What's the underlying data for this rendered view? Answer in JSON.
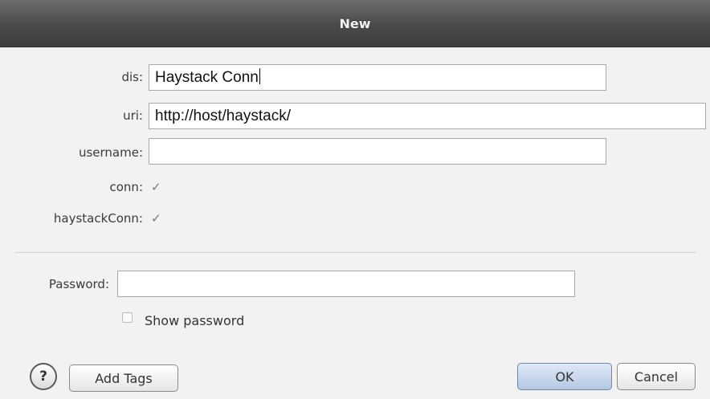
{
  "dialog": {
    "title": "New"
  },
  "fields": {
    "dis": {
      "label": "dis:",
      "value": "Haystack Conn"
    },
    "uri": {
      "label": "uri:",
      "value": "http://host/haystack/"
    },
    "username": {
      "label": "username:",
      "value": ""
    },
    "conn": {
      "label": "conn:",
      "value": "✓"
    },
    "haystackConn": {
      "label": "haystackConn:",
      "value": "✓"
    }
  },
  "password": {
    "label": "Password:",
    "value": "",
    "show_password_label": "Show password",
    "show_password_checked": false
  },
  "footer": {
    "help_label": "?",
    "add_tags_label": "Add Tags",
    "ok_label": "OK",
    "cancel_label": "Cancel"
  }
}
